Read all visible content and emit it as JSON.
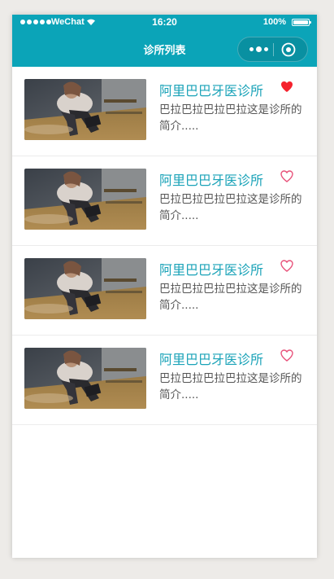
{
  "status_bar": {
    "carrier": "WeChat",
    "time": "16:20",
    "battery": "100%"
  },
  "nav": {
    "title": "诊所列表"
  },
  "clinics": [
    {
      "name": "阿里巴巴牙医诊所",
      "description": "巴拉巴拉巴拉巴拉这是诊所的简介.....",
      "favorited": true
    },
    {
      "name": "阿里巴巴牙医诊所",
      "description": "巴拉巴拉巴拉巴拉这是诊所的简介.....",
      "favorited": false
    },
    {
      "name": "阿里巴巴牙医诊所",
      "description": "巴拉巴拉巴拉巴拉这是诊所的简介.....",
      "favorited": false
    },
    {
      "name": "阿里巴巴牙医诊所",
      "description": "巴拉巴拉巴拉巴拉这是诊所的简介.....",
      "favorited": false
    }
  ],
  "colors": {
    "accent": "#0ba4b8",
    "title_text": "#1aa3b8",
    "heart_filled": "#f5222d",
    "heart_outline": "#e8527a"
  },
  "icons": {
    "favorite_on": "heart-filled-icon",
    "favorite_off": "heart-outline-icon",
    "more": "more-dots-icon",
    "close": "target-close-icon"
  }
}
